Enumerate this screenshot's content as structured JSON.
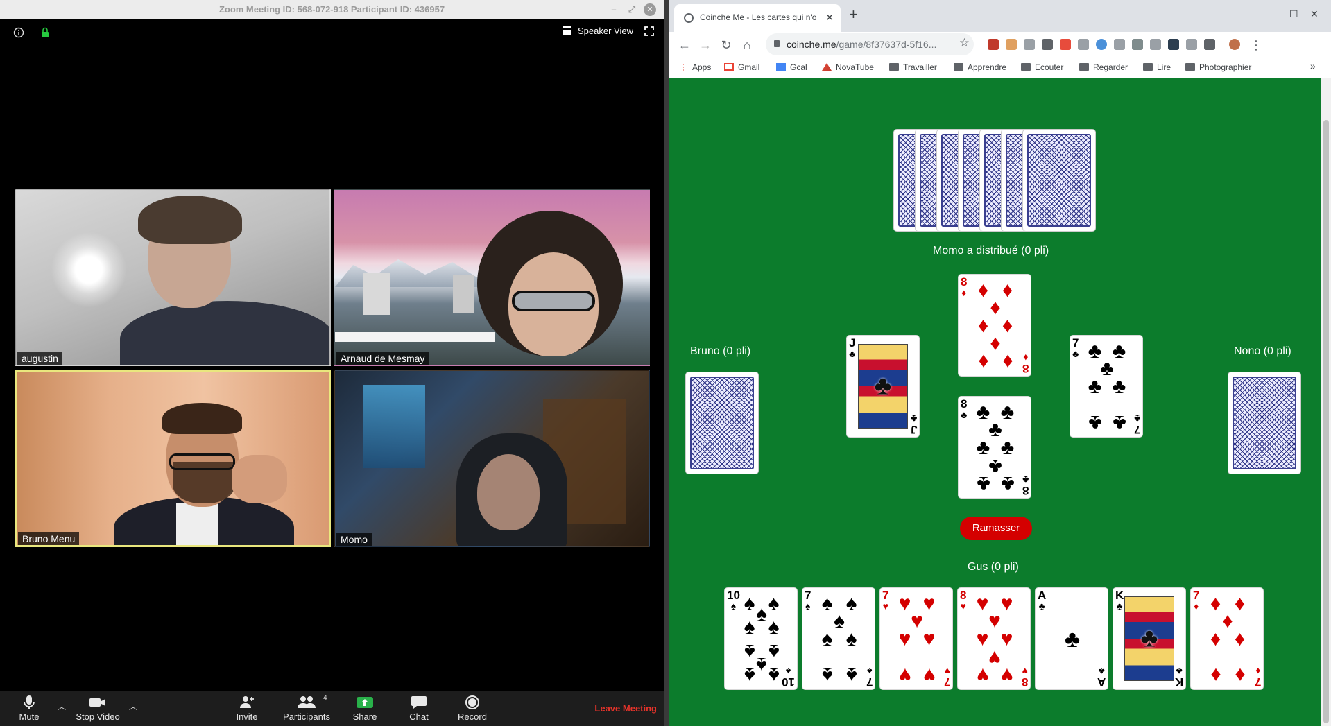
{
  "zoom": {
    "title": "Zoom Meeting ID: 568-072-918 Participant ID: 436957",
    "view_label": "Speaker View",
    "participants": [
      {
        "name": "augustin"
      },
      {
        "name": "Arnaud de Mesmay"
      },
      {
        "name": "Bruno Menu",
        "active": true
      },
      {
        "name": "Momo"
      }
    ],
    "toolbar": {
      "mute": "Mute",
      "stop_video": "Stop Video",
      "invite": "Invite",
      "participants": "Participants",
      "participants_count": "4",
      "share": "Share",
      "chat": "Chat",
      "record": "Record",
      "leave": "Leave Meeting"
    }
  },
  "browser": {
    "tab_title": "Coinche Me - Les cartes qui n'o",
    "url_host": "coinche.me",
    "url_path": "/game/8f37637d-5f16...",
    "bookmarks": [
      "Apps",
      "Gmail",
      "Gcal",
      "NovaTube",
      "Travailler",
      "Apprendre",
      "Ecouter",
      "Regarder",
      "Lire",
      "Photographier"
    ],
    "overflow": "»"
  },
  "game": {
    "top_player": "Momo a distribué (0 pli)",
    "left_player": "Bruno (0 pli)",
    "right_player": "Nono (0 pli)",
    "bottom_player": "Gus (0 pli)",
    "collect_button": "Ramasser",
    "trick": {
      "top": {
        "rank": "8",
        "suit": "♦",
        "color": "red"
      },
      "left": {
        "rank": "J",
        "suit": "♣",
        "color": "blk"
      },
      "right": {
        "rank": "7",
        "suit": "♣",
        "color": "blk"
      },
      "bottom": {
        "rank": "8",
        "suit": "♣",
        "color": "blk"
      }
    },
    "hand": [
      {
        "rank": "10",
        "suit": "♠",
        "color": "blk"
      },
      {
        "rank": "7",
        "suit": "♠",
        "color": "blk"
      },
      {
        "rank": "7",
        "suit": "♥",
        "color": "red"
      },
      {
        "rank": "8",
        "suit": "♥",
        "color": "red"
      },
      {
        "rank": "A",
        "suit": "♣",
        "color": "blk"
      },
      {
        "rank": "K",
        "suit": "♣",
        "color": "blk"
      },
      {
        "rank": "7",
        "suit": "♦",
        "color": "red"
      }
    ],
    "top_card_backs": 7,
    "colors": {
      "table": "#0c7c2c",
      "button": "#d40000"
    }
  }
}
